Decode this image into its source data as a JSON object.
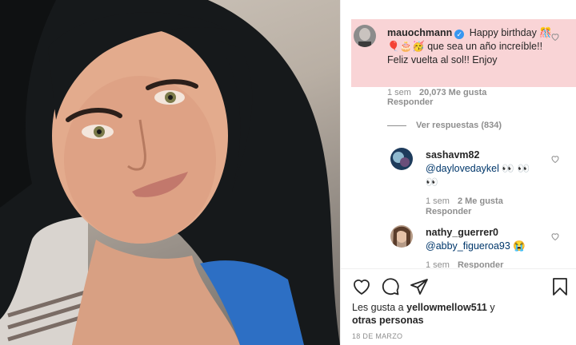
{
  "post": {
    "comments": [
      {
        "username": "mauochmann",
        "verified": true,
        "text_part1": "Happy birthday",
        "emoji1": "🎊🎈🎂🥳",
        "text_part2": "que sea un año increíble!! Feliz vuelta al sol!! Enjoy",
        "time": "1 sem",
        "likes": "20,073 Me gusta",
        "reply": "Responder"
      }
    ],
    "view_replies": "Ver respuestas (834)",
    "replies": [
      {
        "username": "sashavm82",
        "mention": "@daylovedaykel",
        "emoji": "👀 👀 👀",
        "time": "1 sem",
        "likes": "2 Me gusta",
        "reply": "Responder"
      },
      {
        "username": "nathy_guerrer0",
        "mention": "@abby_figueroa93",
        "emoji": "😭",
        "time": "1 sem",
        "reply": "Responder"
      }
    ],
    "liked_by_prefix": "Les gusta a",
    "liked_by_user": "yellowmellow511",
    "liked_by_suffix": "y",
    "liked_by_others": "otras personas",
    "date": "18 DE MARZO"
  },
  "icons": [
    "heart-icon",
    "comment-icon",
    "share-icon",
    "bookmark-icon"
  ],
  "colors": {
    "highlight": "#f9d4d6",
    "text": "#262626",
    "muted": "#8e8e8e",
    "mention": "#00376b",
    "verified": "#3897f0"
  }
}
